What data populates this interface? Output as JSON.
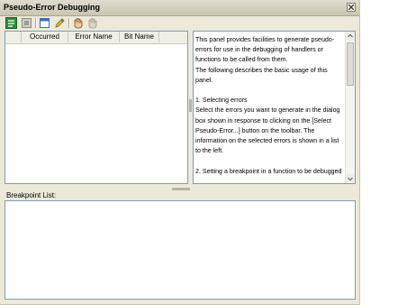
{
  "window": {
    "title": "Pseudo-Error Debugging"
  },
  "toolbar": {
    "buttons": [
      {
        "icon": "select-errors-icon"
      },
      {
        "icon": "clear-icon"
      },
      {
        "icon": "window-icon"
      },
      {
        "icon": "edit-icon"
      },
      {
        "icon": "hand-icon"
      },
      {
        "icon": "hand-disabled-icon"
      }
    ]
  },
  "error_list": {
    "columns": [
      "Occurred",
      "Error Name",
      "Bit Name"
    ],
    "rows": []
  },
  "help": {
    "text": "This panel provides facilities to generate pseudo-errors for use in the debugging of handlers or functions to be called from them.\nThe following describes the basic usage of this panel.\n\n1. Selecting errors\nSelect the errors you want to generate in the dialog box shown in response to clicking on the [Select Pseudo-Error...] button on the toolbar. The information on the selected errors is shown in a list to the left.\n\n2. Setting a breakpoint in a function to be debugged"
  },
  "breakpoints": {
    "label": "Breakpoint List:"
  },
  "colors": {
    "panel_bg": "#ece9d8",
    "border": "#7f9db9"
  }
}
